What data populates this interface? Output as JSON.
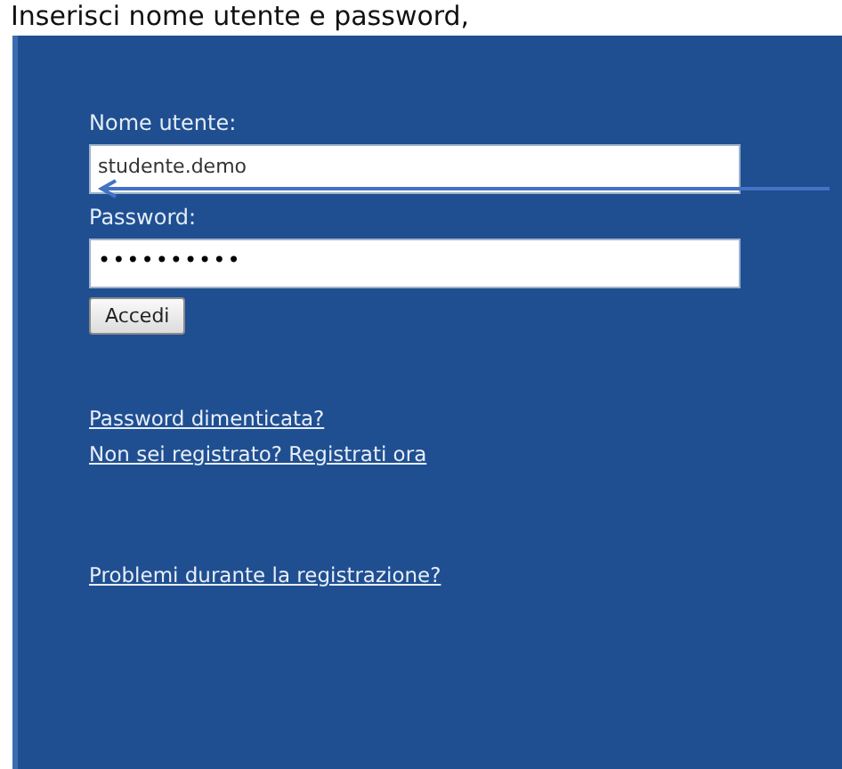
{
  "header_text": "Inserisci nome utente e password,",
  "login": {
    "username_label": "Nome utente:",
    "username_value": "studente.demo",
    "password_label": "Password:",
    "password_value": "••••••••••",
    "submit": "Accedi"
  },
  "links": [
    "Password dimenticata?",
    "Non sei registrato? Registrati ora"
  ],
  "help_links": [
    "Problemi durante la registrazione?"
  ],
  "annotation": {
    "kind": "arrow"
  }
}
